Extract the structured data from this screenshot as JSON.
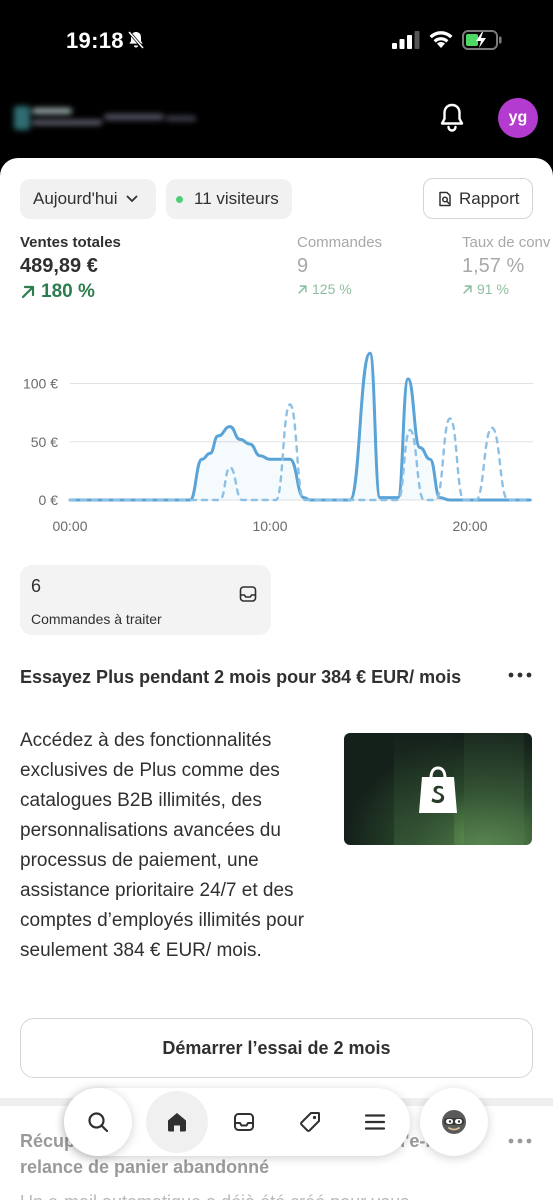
{
  "status_bar": {
    "time": "19:18"
  },
  "header": {
    "avatar_initials": "yg",
    "avatar_color": "#b43bd0"
  },
  "toolbar": {
    "date_filter": "Aujourd'hui",
    "visitors": "11 visiteurs",
    "report_label": "Rapport"
  },
  "metrics": [
    {
      "label": "Ventes totales",
      "value": "489,89 €",
      "delta": "180 %"
    },
    {
      "label": "Commandes",
      "value": "9",
      "delta": "125 %"
    },
    {
      "label": "Taux de conv",
      "value": "1,57 %",
      "delta": "91 %"
    }
  ],
  "chart_data": {
    "type": "line",
    "y_tick_labels": [
      "100 €",
      "50 €",
      "0 €"
    ],
    "x_tick_labels": [
      "00:00",
      "10:00",
      "20:00"
    ],
    "ylim": [
      0,
      130
    ],
    "grid": true,
    "series": [
      {
        "style": "solid",
        "color": "#5aa3d6",
        "points": [
          [
            0,
            0
          ],
          [
            6,
            0
          ],
          [
            6.6,
            35
          ],
          [
            7,
            40
          ],
          [
            7.4,
            55
          ],
          [
            8,
            63
          ],
          [
            8.5,
            52
          ],
          [
            9,
            48
          ],
          [
            9.5,
            38
          ],
          [
            10,
            35
          ],
          [
            11,
            35
          ],
          [
            11.7,
            2
          ],
          [
            12,
            0
          ],
          [
            14,
            0
          ],
          [
            15,
            126
          ],
          [
            15.5,
            2
          ],
          [
            16.4,
            2
          ],
          [
            16.9,
            104
          ],
          [
            17.5,
            45
          ],
          [
            18,
            35
          ],
          [
            18.5,
            2
          ],
          [
            19,
            0
          ],
          [
            23,
            0
          ]
        ]
      },
      {
        "style": "dashed",
        "color": "#8cc0e4",
        "points": [
          [
            0,
            0
          ],
          [
            7.5,
            0
          ],
          [
            8,
            28
          ],
          [
            8.6,
            0
          ],
          [
            10.3,
            0
          ],
          [
            11,
            82
          ],
          [
            11.7,
            0
          ],
          [
            16.4,
            0
          ],
          [
            17,
            60
          ],
          [
            17.7,
            0
          ],
          [
            18.3,
            0
          ],
          [
            19,
            70
          ],
          [
            19.7,
            0
          ],
          [
            20.3,
            0
          ],
          [
            21.1,
            62
          ],
          [
            21.9,
            0
          ],
          [
            23,
            0
          ]
        ]
      }
    ]
  },
  "orders_tile": {
    "count": "6",
    "label": "Commandes à traiter"
  },
  "promo": {
    "title": "Essayez Plus pendant 2 mois pour 384 € EUR/ mois",
    "body": "Accédez à des fonctionnalités exclusives de Plus comme des catalogues B2B illimités, des personnalisations avancées du processus de paiement, une assistance prioritaire 24/7 et des comptes d’employés illimités pour seulement 384 € EUR/ mois.",
    "cta": "Démarrer l’essai de 2 mois"
  },
  "next_card": {
    "title": "Récupérez des paniers abandonnés grâce à l'e-mail relance de panier abandonné",
    "body": "Un e-mail automatique a déjà été créé pour vous"
  },
  "nav": {
    "icons": [
      "search-icon",
      "home-icon",
      "inbox-icon",
      "tag-icon",
      "menu-icon",
      "sidekick-icon"
    ]
  }
}
